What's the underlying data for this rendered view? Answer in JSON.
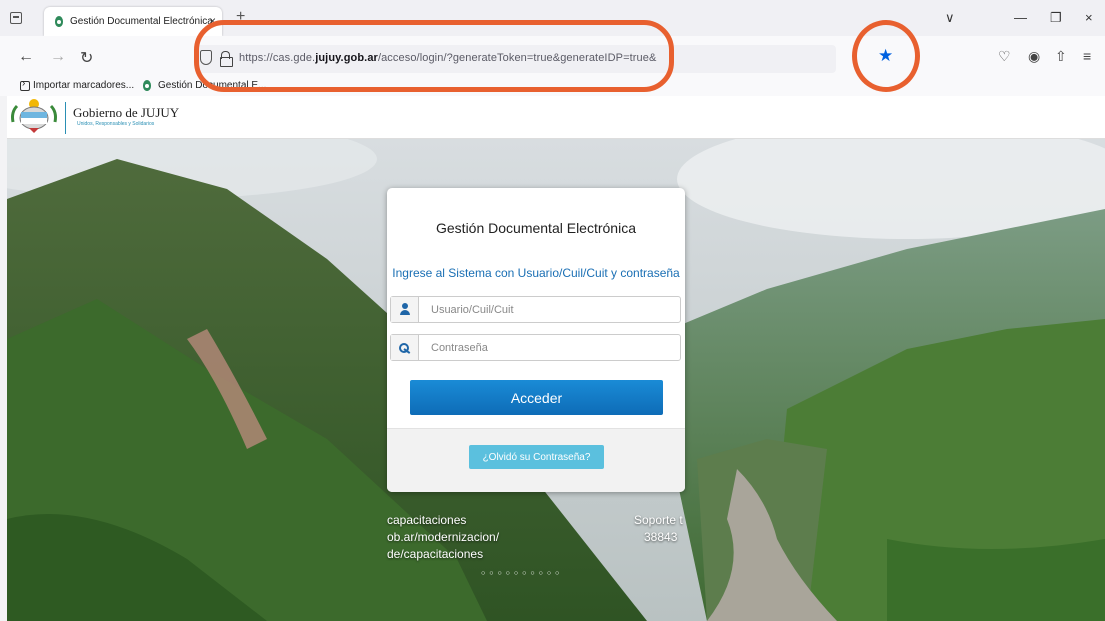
{
  "browser": {
    "tab": {
      "title": "Gestión Documental Electrónica",
      "close": "×"
    },
    "new_tab": "+",
    "window_controls": {
      "list": "∨",
      "minimize": "—",
      "restore": "❐",
      "close": "×"
    },
    "nav": {
      "back": "←",
      "forward": "→",
      "reload": "↻"
    },
    "url": {
      "prefix": "https://cas.gde.",
      "domain": "jujuy.gob.ar",
      "path": "/acceso/login/?generateToken=true&generateIDP=true&"
    },
    "bookmark_star_icon": "star-icon",
    "toolbar_icons": [
      "pocket-icon",
      "account-icon",
      "extensions-icon",
      "menu-icon"
    ],
    "bookmarks": [
      {
        "label": "Importar marcadores...",
        "icon": "import-icon"
      },
      {
        "label": "Gestión Documental E...",
        "icon": "favicon"
      }
    ]
  },
  "site": {
    "logo_title": "Gobierno de JUJUY",
    "logo_subtitle": "Unidos, Responsables y Solidarios"
  },
  "login": {
    "title": "Gestión Documental Electrónica",
    "subtitle": "Ingrese al Sistema con Usuario/Cuil/Cuit y contraseña",
    "username_placeholder": "Usuario/Cuil/Cuit",
    "password_placeholder": "Contraseña",
    "submit_label": "Acceder",
    "forgot_label": "¿Olvidó su Contraseña?"
  },
  "carousel": {
    "left_text": "capacitaciones\nob.ar/modernizacion/\nde/capacitaciones",
    "right_text": "Soporte t\n   38843",
    "dots": "○○○○○○○○○○"
  },
  "colors": {
    "accent": "#0061e0",
    "annotation": "#e8602f",
    "primary_button": "#0e6cb7",
    "link": "#1a6fb4",
    "info_button": "#5bc0de"
  }
}
